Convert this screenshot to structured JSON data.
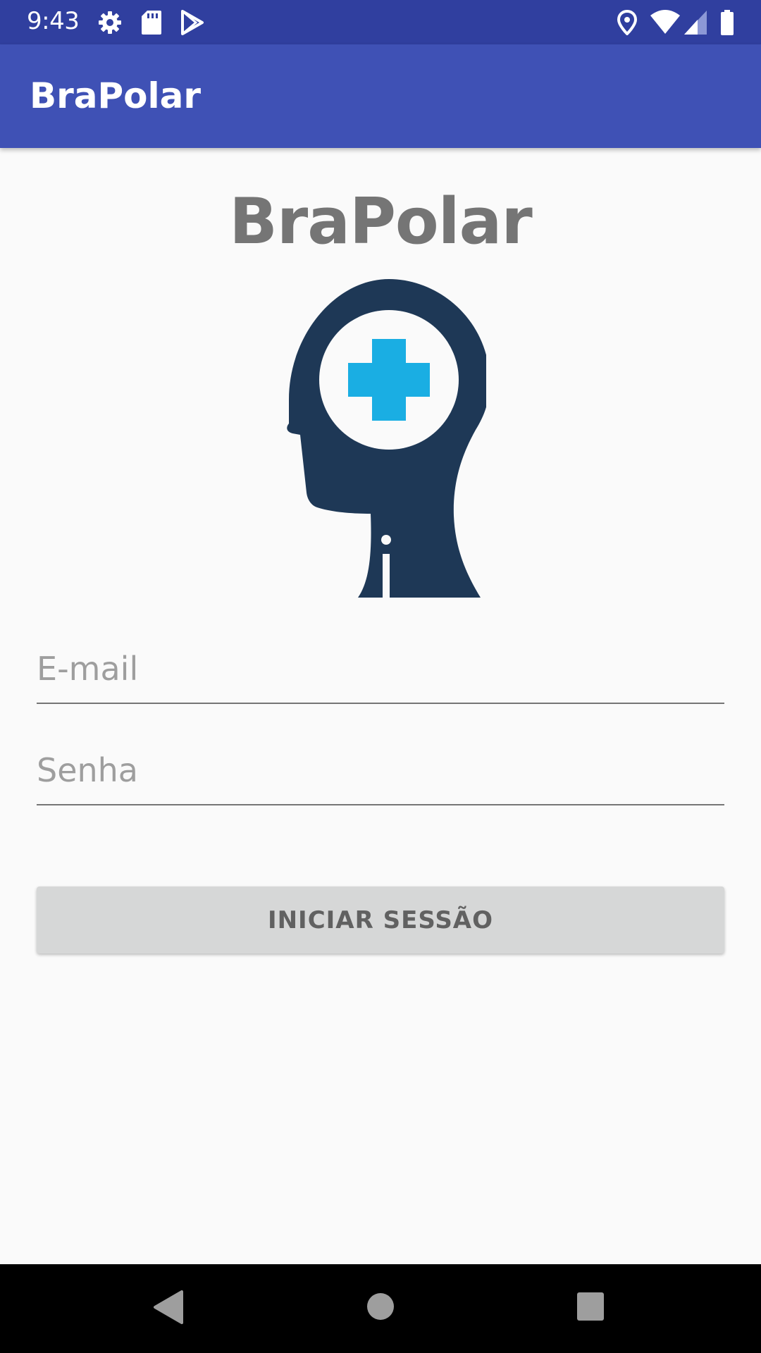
{
  "status_bar": {
    "time": "9:43",
    "left_icons": [
      "gear-icon",
      "sd-card-icon",
      "play-store-icon"
    ],
    "right_icons": [
      "location-icon",
      "wifi-icon",
      "signal-icon",
      "battery-icon"
    ]
  },
  "app_bar": {
    "title": "BraPolar"
  },
  "login": {
    "brand_title": "BraPolar",
    "email_placeholder": "E-mail",
    "password_placeholder": "Senha",
    "submit_label": "INICIAR SESSÃO"
  },
  "colors": {
    "status_bar": "#303f9f",
    "app_bar": "#3f51b5",
    "logo_head": "#1e3856",
    "logo_cross": "#1aaee3",
    "button_bg": "#d6d7d7"
  },
  "nav_bar": {
    "icons": [
      "back-icon",
      "home-icon",
      "recents-icon"
    ]
  }
}
